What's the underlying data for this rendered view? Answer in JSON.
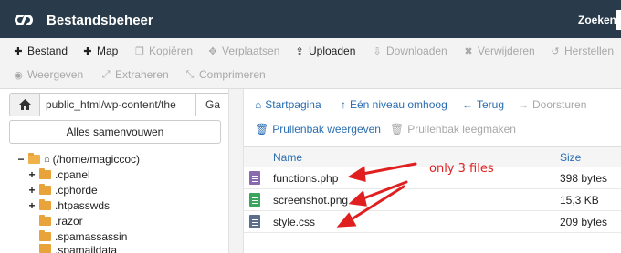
{
  "header": {
    "title": "Bestandsbeheer",
    "search_label": "Zoeken"
  },
  "toolbar": {
    "items": [
      {
        "label": "Bestand",
        "icon": "plus-icon",
        "enabled": true
      },
      {
        "label": "Map",
        "icon": "plus-icon",
        "enabled": true
      },
      {
        "label": "Kopiëren",
        "icon": "copy-icon",
        "enabled": false
      },
      {
        "label": "Verplaatsen",
        "icon": "move-icon",
        "enabled": false
      },
      {
        "label": "Uploaden",
        "icon": "upload-icon",
        "enabled": true
      },
      {
        "label": "Downloaden",
        "icon": "download-icon",
        "enabled": false
      },
      {
        "label": "Verwijderen",
        "icon": "times-icon",
        "enabled": false
      },
      {
        "label": "Herstellen",
        "icon": "undo-icon",
        "enabled": false
      },
      {
        "label": "Weergeven",
        "icon": "eye-icon",
        "enabled": false
      },
      {
        "label": "Extraheren",
        "icon": "expand-icon",
        "enabled": false
      },
      {
        "label": "Comprimeren",
        "icon": "compress-icon",
        "enabled": false
      }
    ]
  },
  "left_panel": {
    "path_value": "public_html/wp-content/the",
    "go_label": "Ga",
    "collapse_label": "Alles samenvouwen",
    "tree": [
      {
        "toggle": "−",
        "label": "(/home/magiccoc)",
        "kind": "home"
      },
      {
        "toggle": "+",
        "label": ".cpanel",
        "kind": "folder"
      },
      {
        "toggle": "+",
        "label": ".cphorde",
        "kind": "folder"
      },
      {
        "toggle": "+",
        "label": ".htpasswds",
        "kind": "folder"
      },
      {
        "toggle": "",
        "label": ".razor",
        "kind": "folder"
      },
      {
        "toggle": "",
        "label": ".spamassassin",
        "kind": "folder"
      },
      {
        "toggle": "",
        "label": ".spamaildata",
        "kind": "folder"
      }
    ]
  },
  "right_panel": {
    "nav": [
      {
        "label": "Startpagina",
        "icon": "home-icon",
        "enabled": true
      },
      {
        "label": "Eén niveau omhoog",
        "icon": "level-up-icon",
        "enabled": true
      },
      {
        "label": "Terug",
        "icon": "arrow-left-icon",
        "enabled": true
      },
      {
        "label": "Doorsturen",
        "icon": "arrow-right-icon",
        "enabled": false
      },
      {
        "label": "Prullenbak weergeven",
        "icon": "trash-icon",
        "enabled": true
      },
      {
        "label": "Prullenbak leegmaken",
        "icon": "trash-icon",
        "enabled": false
      }
    ],
    "columns": {
      "name": "Name",
      "size": "Size"
    },
    "files": [
      {
        "name": "functions.php",
        "size": "398 bytes",
        "type": "php"
      },
      {
        "name": "screenshot.png",
        "size": "15,3 KB",
        "type": "png"
      },
      {
        "name": "style.css",
        "size": "209 bytes",
        "type": "css"
      }
    ]
  },
  "annotation": {
    "text": "only 3 files",
    "color": "#e02020"
  },
  "colors": {
    "header_bg": "#293a4a",
    "link_blue": "#2a6db0",
    "folder": "#e8a33a"
  }
}
